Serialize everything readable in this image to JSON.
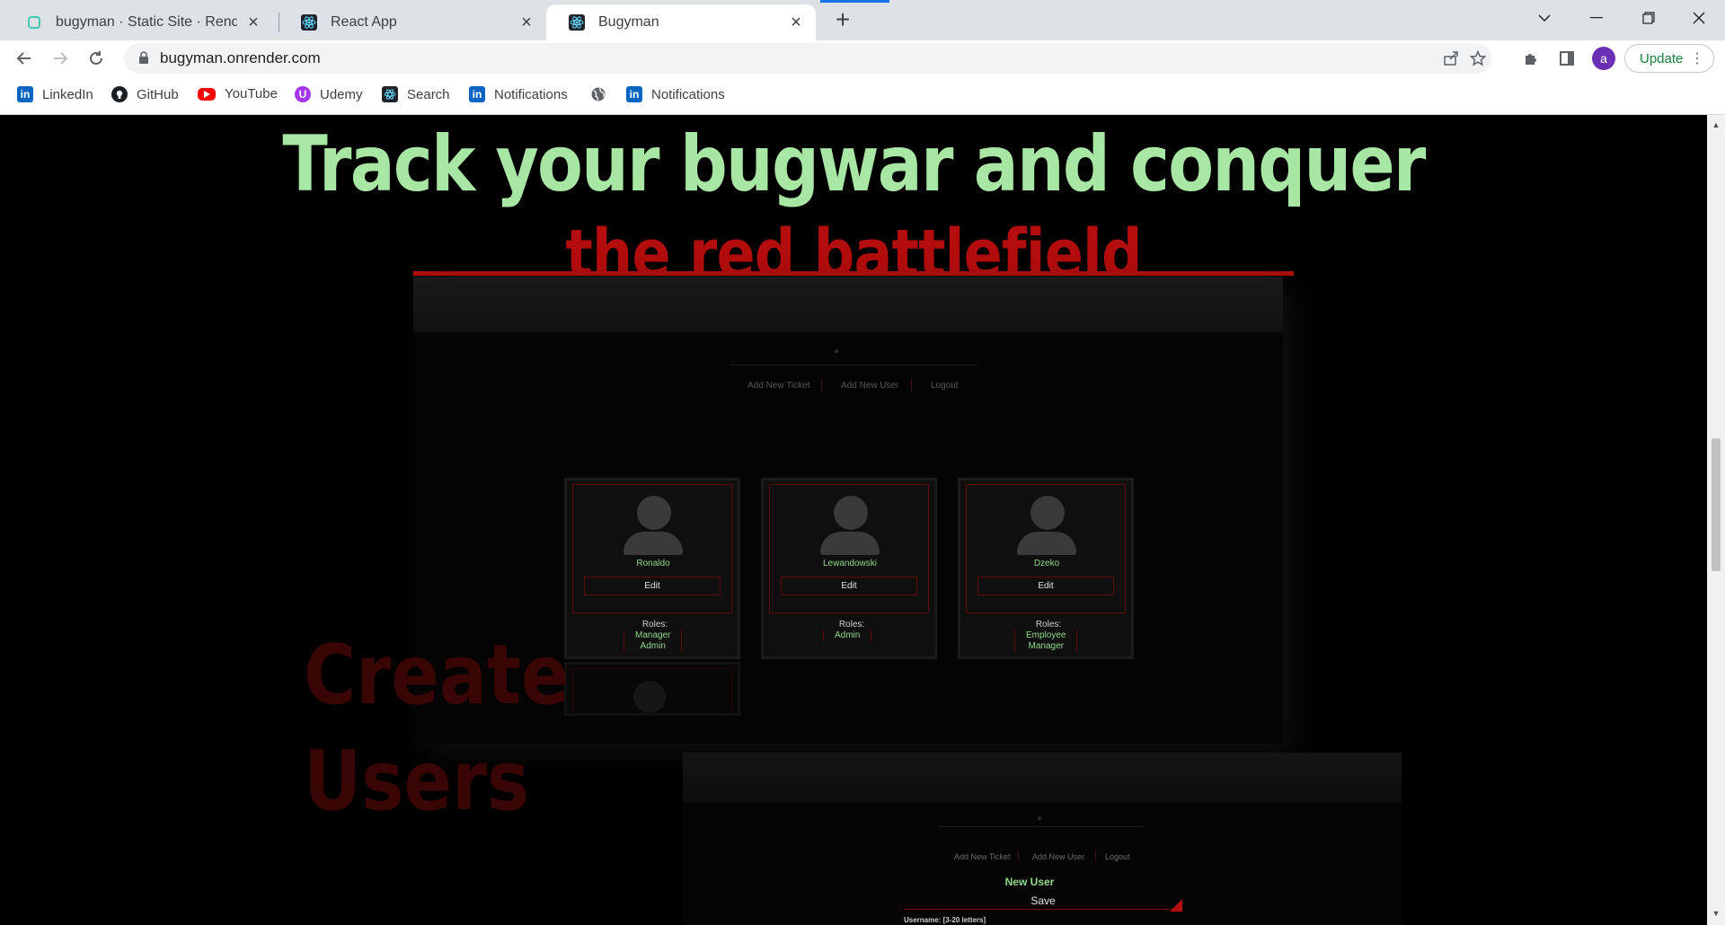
{
  "browser": {
    "tabs": [
      {
        "title": "bugyman · Static Site · Render D",
        "active": false
      },
      {
        "title": "React App",
        "active": false
      },
      {
        "title": "Bugyman",
        "active": true
      }
    ],
    "url": "bugyman.onrender.com",
    "avatar_letter": "a",
    "update_label": "Update",
    "bookmarks": [
      {
        "label": "LinkedIn",
        "icon": "linkedin-icon"
      },
      {
        "label": "GitHub",
        "icon": "github-icon"
      },
      {
        "label": "YouTube",
        "icon": "youtube-icon"
      },
      {
        "label": "Udemy",
        "icon": "udemy-icon"
      },
      {
        "label": "Search",
        "icon": "react-icon"
      },
      {
        "label": "Notifications",
        "icon": "linkedin-icon"
      },
      {
        "label": "",
        "icon": "globe-icon"
      },
      {
        "label": "Notifications",
        "icon": "linkedin-icon"
      }
    ]
  },
  "hero": {
    "line1": "Track your bugwar and conquer",
    "line2": "the red battlefield"
  },
  "screenshot1": {
    "nav": [
      "Add New Ticket",
      "Add New User",
      "Logout"
    ],
    "users": [
      {
        "name": "Ronaldo",
        "edit": "Edit",
        "roles_label": "Roles:",
        "roles": [
          "Manager",
          "Admin"
        ]
      },
      {
        "name": "Lewandowski",
        "edit": "Edit",
        "roles_label": "Roles:",
        "roles": [
          "Admin"
        ]
      },
      {
        "name": "Dzeko",
        "edit": "Edit",
        "roles_label": "Roles:",
        "roles": [
          "Employee",
          "Manager"
        ]
      }
    ]
  },
  "section2": {
    "title_line1": "Create",
    "title_line2": "Users"
  },
  "screenshot2": {
    "nav": [
      "Add New Ticket",
      "Add New User",
      "Logout"
    ],
    "form_title": "New User",
    "save_label": "Save",
    "username_hint": "Username: [3-20 letters]"
  },
  "colors": {
    "accent_green": "#a8e6a3",
    "accent_red": "#b30d0d",
    "background": "#000000"
  }
}
